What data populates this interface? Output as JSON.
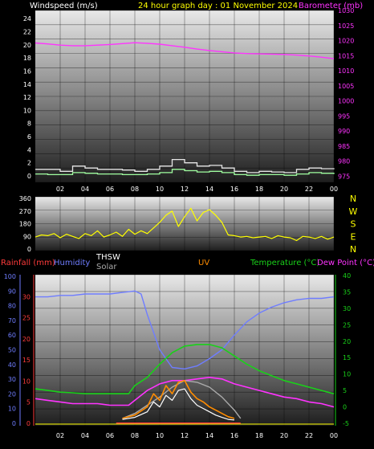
{
  "title": "24 hour graph day : 01 November 2024",
  "colors": {
    "background": "#000000",
    "wind_avg": "#a0ffa0",
    "wind_gust": "#e6e6e6",
    "barometer": "#ff33ff",
    "wind_dir": "#ffff00",
    "rain": "#ff3b3b",
    "humidity": "#6f7dff",
    "thsw": "#ffffff",
    "solar": "#aaaaaa",
    "uv": "#ff8c00",
    "temperature": "#19d119",
    "dew_point": "#ff33ff"
  },
  "chart_data": [
    {
      "type": "line",
      "x_ticks": [
        "02",
        "04",
        "06",
        "08",
        "10",
        "12",
        "14",
        "16",
        "18",
        "20",
        "22",
        "00"
      ],
      "left_axis": {
        "label": "Windspeed (m/s)",
        "ylim": [
          0,
          25
        ],
        "ticks": [
          "0",
          "2",
          "4",
          "6",
          "8",
          "10",
          "12",
          "14",
          "16",
          "18",
          "20",
          "22",
          "24"
        ]
      },
      "right_axis": {
        "label": "Barometer (mb)",
        "ylim": [
          973,
          1030
        ],
        "ticks": [
          "975",
          "980",
          "985",
          "990",
          "995",
          "1000",
          "1005",
          "1010",
          "1015",
          "1020",
          "1025",
          "1030"
        ]
      },
      "series": [
        {
          "name": "Barometer (mb)",
          "axis": "right",
          "x": [
            0,
            1,
            2,
            3,
            4,
            5,
            6,
            7,
            8,
            9,
            10,
            11,
            12,
            13,
            14,
            15,
            16,
            17,
            18,
            19,
            20,
            21,
            22,
            23,
            24
          ],
          "values": [
            1019.2,
            1018.9,
            1018.5,
            1018.3,
            1018.3,
            1018.5,
            1018.7,
            1019.0,
            1019.3,
            1019.1,
            1018.8,
            1018.3,
            1017.8,
            1017.2,
            1016.7,
            1016.3,
            1015.9,
            1015.7,
            1015.6,
            1015.5,
            1015.4,
            1015.2,
            1014.9,
            1014.5,
            1014.0
          ]
        },
        {
          "axis": "left",
          "x": [
            0,
            1,
            2,
            3,
            4,
            5,
            6,
            7,
            8,
            9,
            10,
            11,
            12,
            13,
            14,
            15,
            16,
            17,
            18,
            19,
            20,
            21,
            22,
            23,
            24
          ],
          "values": [
            1.0,
            1.0,
            0.7,
            1.5,
            1.2,
            1.0,
            1.0,
            0.9,
            0.7,
            1.0,
            1.5,
            2.5,
            2.0,
            1.5,
            1.6,
            1.2,
            0.7,
            0.5,
            0.7,
            0.6,
            0.5,
            1.0,
            1.2,
            1.1,
            1.0
          ]
        },
        {
          "axis": "left",
          "x": [
            0,
            1,
            2,
            3,
            4,
            5,
            6,
            7,
            8,
            9,
            10,
            11,
            12,
            13,
            14,
            15,
            16,
            17,
            18,
            19,
            20,
            21,
            22,
            23,
            24
          ],
          "values": [
            0.3,
            0.2,
            0.2,
            0.5,
            0.4,
            0.3,
            0.3,
            0.2,
            0.2,
            0.3,
            0.5,
            1.0,
            0.8,
            0.6,
            0.7,
            0.5,
            0.2,
            0.1,
            0.2,
            0.2,
            0.1,
            0.3,
            0.5,
            0.4,
            0.3
          ]
        }
      ]
    },
    {
      "type": "line",
      "x_ticks": [],
      "left_axis": {
        "label": "",
        "ylim": [
          0,
          360
        ],
        "ticks": [
          "0",
          "90",
          "180",
          "270",
          "360"
        ]
      },
      "right_axis": {
        "label": "",
        "ticks": [
          "N",
          "W",
          "S",
          "E",
          "N"
        ]
      },
      "series": [
        {
          "axis": "left",
          "x": [
            0,
            0.5,
            1,
            1.5,
            2,
            2.5,
            3,
            3.5,
            4,
            4.5,
            5,
            5.5,
            6,
            6.5,
            7,
            7.5,
            8,
            8.5,
            9,
            9.5,
            10,
            10.5,
            11,
            11.5,
            12,
            12.5,
            13,
            13.5,
            14,
            14.5,
            15,
            15.5,
            16,
            16.5,
            17,
            17.5,
            18,
            18.5,
            19,
            19.5,
            20,
            20.5,
            21,
            21.5,
            22,
            22.5,
            23,
            23.5,
            24
          ],
          "values": [
            85,
            100,
            95,
            110,
            80,
            105,
            90,
            75,
            110,
            95,
            130,
            85,
            100,
            120,
            90,
            140,
            105,
            130,
            110,
            150,
            190,
            240,
            270,
            160,
            230,
            290,
            200,
            260,
            280,
            240,
            190,
            100,
            95,
            85,
            90,
            80,
            85,
            90,
            75,
            95,
            85,
            80,
            60,
            90,
            85,
            75,
            90,
            70,
            85
          ]
        }
      ]
    },
    {
      "type": "line",
      "x_ticks": [
        "02",
        "04",
        "06",
        "08",
        "10",
        "12",
        "14",
        "16",
        "18",
        "20",
        "22",
        "00"
      ],
      "left_axis": {
        "label": "Rainfall (mm)",
        "ylim": [
          0,
          35
        ],
        "ticks": [
          "0",
          "5",
          "10",
          "15",
          "20",
          "25",
          "30"
        ]
      },
      "humidity_axis": {
        "label": "Humidity",
        "ylim": [
          0,
          100
        ],
        "ticks": [
          "0",
          "10",
          "20",
          "30",
          "40",
          "50",
          "60",
          "70",
          "80",
          "90",
          "100"
        ]
      },
      "right_axis": {
        "label": "Temperature (°C)",
        "ylim": [
          -5,
          40
        ],
        "ticks": [
          "-5",
          "0",
          "5",
          "10",
          "15",
          "20",
          "25",
          "30",
          "35",
          "40"
        ]
      },
      "other_labels": [
        "THSW",
        "Solar",
        "UV",
        "Dew Point (°C)"
      ],
      "series": [
        {
          "axis": "humidity",
          "x": [
            0,
            1,
            2,
            3,
            4,
            5,
            6,
            7,
            8,
            8.5,
            9,
            10,
            11,
            12,
            13,
            14,
            15,
            16,
            17,
            18,
            19,
            20,
            21,
            22,
            23,
            24
          ],
          "values": [
            86,
            86,
            87,
            87,
            88,
            88,
            88,
            89,
            90,
            88,
            74,
            50,
            38,
            37,
            39,
            44,
            50,
            60,
            69,
            75,
            79,
            82,
            84,
            85,
            85,
            86
          ]
        },
        {
          "axis": "right",
          "x": [
            0,
            1,
            2,
            3,
            4,
            5,
            6,
            7,
            7.5,
            8,
            9,
            10,
            11,
            12,
            13,
            14,
            15,
            16,
            17,
            18,
            19,
            20,
            21,
            22,
            23,
            24
          ],
          "values": [
            5.5,
            5.0,
            4.5,
            4.3,
            4.0,
            4.0,
            4.0,
            4.0,
            4.0,
            6.5,
            9.0,
            13.0,
            16.5,
            18.5,
            19.0,
            19.0,
            18.0,
            15.5,
            13.0,
            11.0,
            9.5,
            8.0,
            7.0,
            6.0,
            5.0,
            4.0
          ]
        },
        {
          "axis": "right",
          "x": [
            0,
            1,
            2,
            3,
            4,
            5,
            6,
            7,
            7.5,
            8,
            9,
            10,
            11,
            12,
            13,
            14,
            15,
            16,
            17,
            18,
            19,
            20,
            21,
            22,
            23,
            24
          ],
          "values": [
            2.5,
            2.0,
            1.5,
            1.0,
            1.0,
            1.0,
            0.5,
            0.5,
            0.5,
            2.0,
            5.0,
            7.0,
            8.0,
            8.0,
            8.5,
            9.0,
            8.5,
            7.0,
            6.0,
            5.0,
            4.0,
            3.0,
            2.5,
            1.5,
            1.0,
            0.0
          ]
        },
        {
          "axis": "right",
          "x": [
            7,
            8,
            9,
            10,
            11,
            12,
            13,
            14,
            15,
            16,
            16.5
          ],
          "values": [
            -3.5,
            -2.0,
            0.5,
            3.0,
            6.0,
            8.0,
            7.5,
            6.0,
            3.0,
            -1.0,
            -3.5
          ]
        },
        {
          "axis": "right",
          "x": [
            7,
            8,
            9,
            9.5,
            10,
            10.5,
            11,
            11.5,
            12,
            12.5,
            13,
            13.5,
            14,
            14.5,
            15,
            15.5,
            16
          ],
          "values": [
            -3.5,
            -2.5,
            0.0,
            4.0,
            2.0,
            6.5,
            4.0,
            7.5,
            8.0,
            4.5,
            2.5,
            1.5,
            0.0,
            -1.0,
            -2.0,
            -3.0,
            -3.5
          ]
        },
        {
          "axis": "right",
          "x": [
            7,
            8,
            9,
            9.5,
            10,
            10.5,
            11,
            11.5,
            12,
            12.5,
            13,
            13.5,
            14,
            14.5,
            15,
            15.5,
            16
          ],
          "values": [
            -3.8,
            -3.2,
            -1.5,
            1.5,
            0.0,
            3.5,
            2.0,
            5.0,
            5.5,
            2.5,
            0.5,
            -0.5,
            -1.5,
            -2.5,
            -3.2,
            -3.8,
            -4.0
          ]
        }
      ]
    }
  ]
}
